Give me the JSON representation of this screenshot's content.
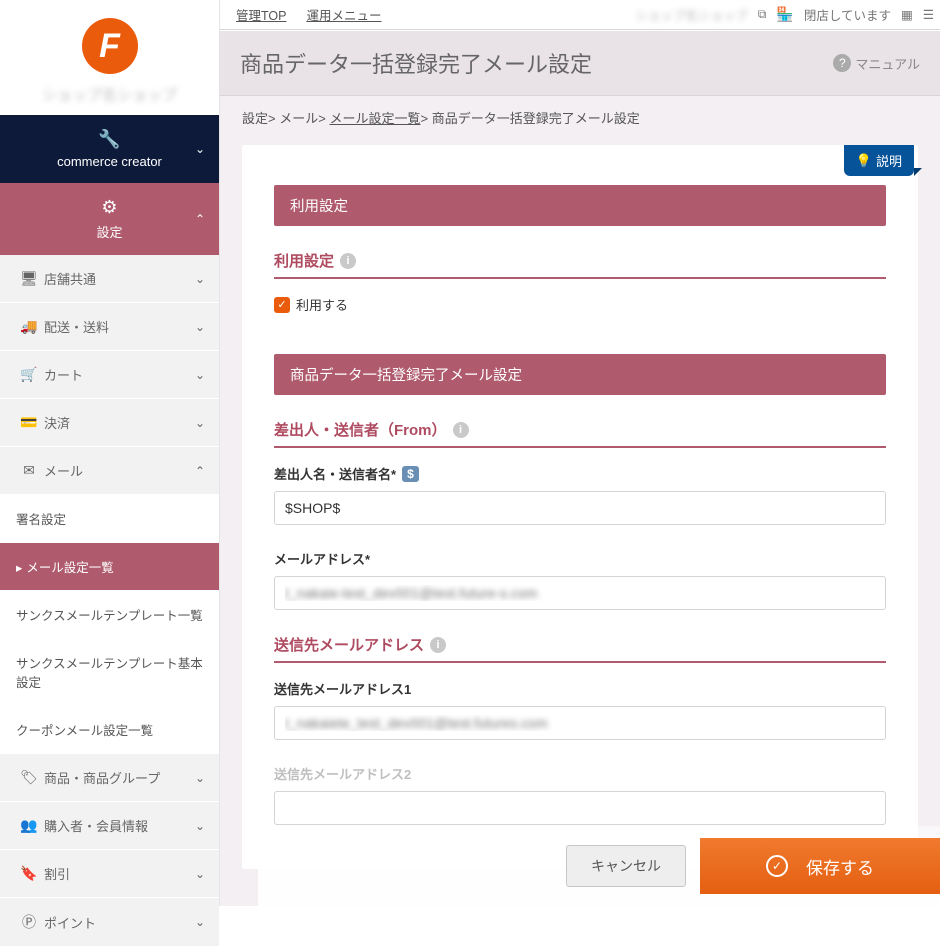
{
  "logo_letter": "F",
  "shop_name_blur": "ショップ名ショップ",
  "nav": {
    "commerce": "commerce creator",
    "settings": "設定",
    "items": [
      {
        "icon": "🖥",
        "label": "店舗共通"
      },
      {
        "icon": "🚚",
        "label": "配送・送料"
      },
      {
        "icon": "🛒",
        "label": "カート"
      },
      {
        "icon": "💳",
        "label": "決済"
      },
      {
        "icon": "✉",
        "label": "メール"
      }
    ],
    "mail_sub": [
      "署名設定",
      "メール設定一覧",
      "サンクスメールテンプレート一覧",
      "サンクスメールテンプレート基本設定",
      "クーポンメール設定一覧"
    ],
    "rest": [
      {
        "icon": "🏷",
        "label": "商品・商品グループ"
      },
      {
        "icon": "👥",
        "label": "購入者・会員情報"
      },
      {
        "icon": "🔖",
        "label": "割引"
      },
      {
        "icon": "Ⓟ",
        "label": "ポイント"
      }
    ]
  },
  "topbar": {
    "tab1": "管理TOP",
    "tab2": "運用メニュー",
    "shop_header": "ショップ名ショップ",
    "closed": "閉店しています"
  },
  "page_title": "商品データ一括登録完了メール設定",
  "manual": "マニュアル",
  "breadcrumb": {
    "a": "設定",
    "b": "メール",
    "c": "メール設定一覧",
    "d": "商品データ一括登録完了メール設定"
  },
  "explain": "説明",
  "sections": {
    "usage_bar": "利用設定",
    "usage_title": "利用設定",
    "use_label": "利用する",
    "mail_bar": "商品データ一括登録完了メール設定",
    "from_title": "差出人・送信者（From）",
    "sender_name_label": "差出人名・送信者名*",
    "sender_name_value": "$SHOP$",
    "mail_addr_label": "メールアドレス*",
    "mail_addr_value": "t_nakaie-test_dev001@test.future-s.com",
    "dest_title": "送信先メールアドレス",
    "dest1_label": "送信先メールアドレス1",
    "dest1_value": "t_nakaiete_test_dev001@test.futures.com",
    "dest2_label": "送信先メールアドレス2"
  },
  "footer": {
    "cancel": "キャンセル",
    "save": "保存する"
  }
}
